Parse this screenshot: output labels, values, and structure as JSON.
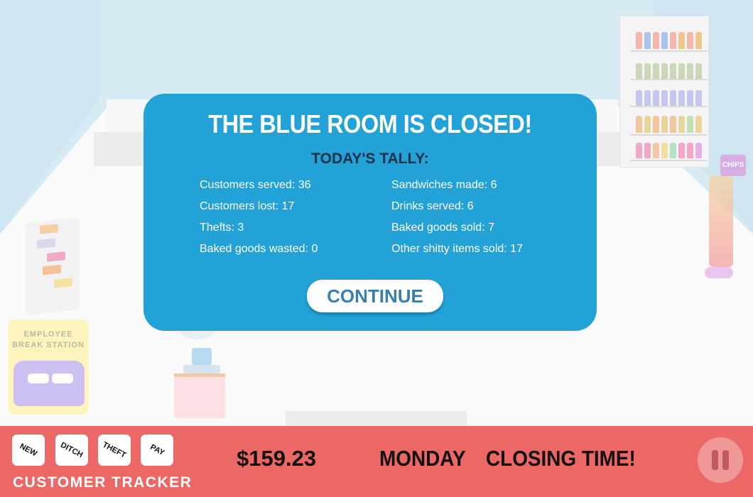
{
  "colors": {
    "modal_bg": "#22a2d6",
    "bottom_bar": "#ec6867",
    "tally_heading": "#14324a",
    "continue_text": "#3a7eb0"
  },
  "scene": {
    "chips_sign": "CHIPS",
    "break_station": "EMPLOYEE BREAK STATION"
  },
  "modal": {
    "title": "THE BLUE ROOM IS CLOSED!",
    "tally_heading": "TODAY'S TALLY:",
    "stats_left": [
      "Customers served: 36",
      "Customers lost: 17",
      "Thefts: 3",
      "Baked goods wasted: 0"
    ],
    "stats_right": [
      "Sandwiches made: 6",
      "Drinks served: 6",
      "Baked goods sold: 7",
      "Other shitty items sold: 17"
    ],
    "continue_label": "CONTINUE"
  },
  "bottom_bar": {
    "tracker_buttons": [
      "NEW",
      "DITCH",
      "THEFT",
      "PAY"
    ],
    "tracker_label": "CUSTOMER TRACKER",
    "money": "$159.23",
    "day": "MONDAY",
    "status": "CLOSING TIME!",
    "pause_icon": "pause-icon"
  }
}
